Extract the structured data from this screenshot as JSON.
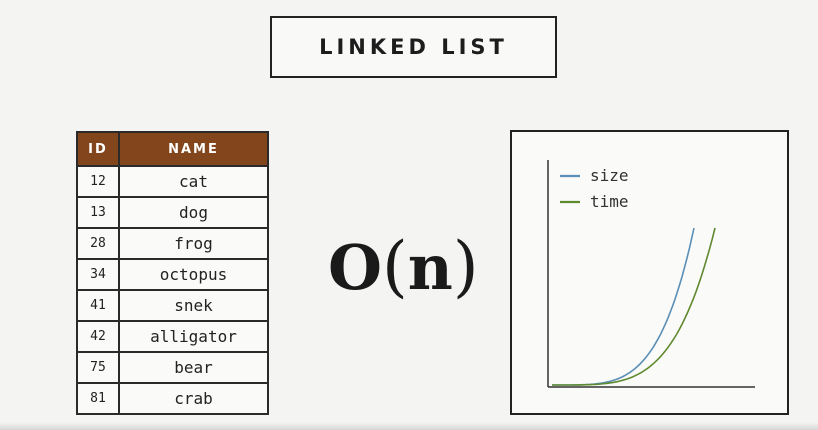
{
  "title": "LINKED LIST",
  "table": {
    "headers": {
      "id": "ID",
      "name": "NAME"
    },
    "rows": [
      {
        "id": "12",
        "name": "cat"
      },
      {
        "id": "13",
        "name": "dog"
      },
      {
        "id": "28",
        "name": "frog"
      },
      {
        "id": "34",
        "name": "octopus"
      },
      {
        "id": "41",
        "name": "snek"
      },
      {
        "id": "42",
        "name": "alligator"
      },
      {
        "id": "75",
        "name": "bear"
      },
      {
        "id": "81",
        "name": "crab"
      }
    ]
  },
  "complexity": {
    "o": "O",
    "open": "(",
    "n": "n",
    "close": ")"
  },
  "chart": {
    "legend": [
      {
        "label": "size",
        "color": "#5b8fb5"
      },
      {
        "label": "time",
        "color": "#5f8a2e"
      }
    ]
  },
  "colors": {
    "header_bg": "#82451c",
    "accent_size": "#5b8fb5",
    "accent_time": "#5f8a2e"
  }
}
